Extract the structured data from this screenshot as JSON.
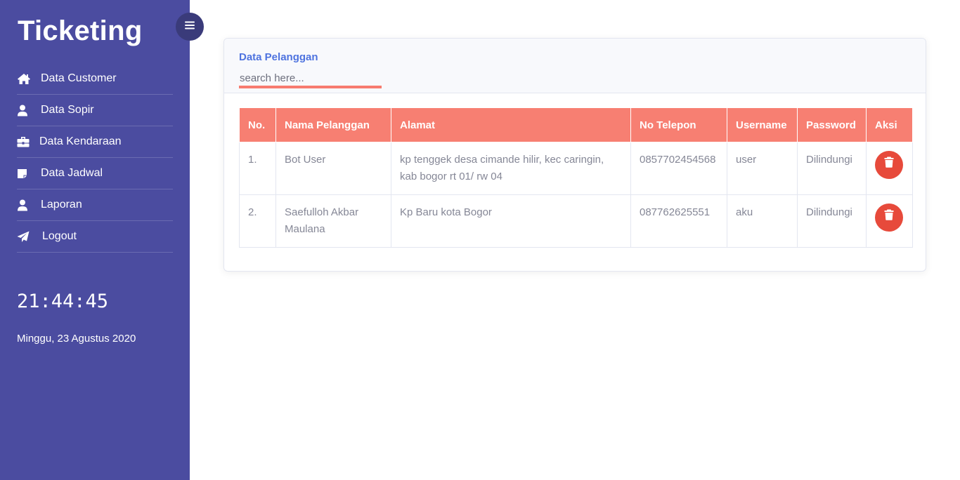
{
  "sidebar": {
    "brand": "Ticketing",
    "items": [
      {
        "label": "Data Customer",
        "icon": "home-icon"
      },
      {
        "label": "Data Sopir",
        "icon": "user-icon"
      },
      {
        "label": "Data Kendaraan",
        "icon": "briefcase-icon"
      },
      {
        "label": "Data Jadwal",
        "icon": "sticky-note-icon"
      },
      {
        "label": "Laporan",
        "icon": "user-icon"
      },
      {
        "label": "Logout",
        "icon": "paper-plane-icon"
      }
    ],
    "clock": "21:44:45",
    "date": "Minggu, 23 Agustus 2020",
    "background_color": "#4b4ca0"
  },
  "toggle": {
    "icon": "menu-icon"
  },
  "card": {
    "title": "Data Pelanggan",
    "search": {
      "placeholder": "search here..."
    }
  },
  "table": {
    "headers": [
      "No.",
      "Nama Pelanggan",
      "Alamat",
      "No Telepon",
      "Username",
      "Password",
      "Aksi"
    ],
    "rows": [
      {
        "no": "1.",
        "nama": "Bot User",
        "alamat": "kp tenggek desa cimande hilir, kec caringin, kab bogor rt 01/ rw 04",
        "telepon": "0857702454568",
        "username": "user",
        "password": "Dilindungi",
        "action_icon": "trash-icon"
      },
      {
        "no": "2.",
        "nama": "Saefulloh Akbar Maulana",
        "alamat": "Kp Baru kota Bogor",
        "telepon": "087762625551",
        "username": "aku",
        "password": "Dilindungi",
        "action_icon": "trash-icon"
      }
    ],
    "header_color": "#f77f72",
    "delete_color": "#e74a3b"
  }
}
